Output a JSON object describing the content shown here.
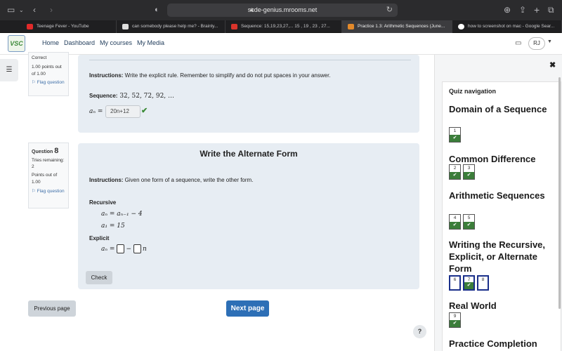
{
  "browser": {
    "url": "scde-genius.mrooms.net",
    "tabs": [
      {
        "label": "Teenage Fever - YouTube",
        "color": "#e22a2a"
      },
      {
        "label": "can somebody please help me? - Brainly...",
        "color": "#dddddd"
      },
      {
        "label": "Sequence: 15,19,23,27,... 15 , 19 , 23 , 27...",
        "color": "#d9342b"
      },
      {
        "label": "Practice 1.3: Arithmetic Sequences (June...",
        "color": "#e48a2a"
      },
      {
        "label": "how to screenshot on mac - Google Sear...",
        "color": "#ffffff"
      }
    ]
  },
  "site": {
    "logo_text": "VSC",
    "nav": {
      "home": "Home",
      "dashboard": "Dashboard",
      "courses": "My courses",
      "media": "My Media"
    },
    "user_initials": "RJ"
  },
  "q7": {
    "status": "Correct",
    "points": "1.00 points out of 1.00",
    "flag": "Flag question",
    "instructions_label": "Instructions:",
    "instructions": " Write the explicit rule. Remember to simplify and do not put spaces in your answer.",
    "sequence_label": "Sequence:",
    "sequence": " 32, 52, 72, 92, …",
    "lhs": "aₙ =",
    "answer": "20n+12"
  },
  "q8": {
    "label": "Question",
    "number": "8",
    "tries": "Tries remaining: 2",
    "points": "Points out of 1.00",
    "flag": "Flag question",
    "title": "Write the Alternate Form",
    "instructions_label": "Instructions:",
    "instructions": " Given one form of a sequence, write the other form.",
    "recursive_label": "Recursive",
    "recursive_eq1": "aₙ = aₙ₋₁ − 4",
    "recursive_eq2": "a₁ = 15",
    "explicit_label": "Explicit",
    "explicit_lhs": "aₙ =",
    "explicit_minus": "−",
    "explicit_var": "n",
    "check": "Check"
  },
  "footer": {
    "prev": "Previous page",
    "next": "Next page",
    "help": "?"
  },
  "quiz_nav": {
    "title": "Quiz navigation",
    "sections": [
      {
        "title": "Domain of a Sequence",
        "questions": [
          {
            "n": "1",
            "state": "done"
          }
        ]
      },
      {
        "title": "Common Difference",
        "questions": [
          {
            "n": "2",
            "state": "done"
          },
          {
            "n": "3",
            "state": "done"
          }
        ]
      },
      {
        "title": "Arithmetic Sequences",
        "questions": [
          {
            "n": "4",
            "state": "done"
          },
          {
            "n": "5",
            "state": "done"
          }
        ]
      },
      {
        "title": "Writing the Recursive, Explicit, or Alternate Form",
        "questions": [
          {
            "n": "6",
            "state": "unanswered"
          },
          {
            "n": "7",
            "state": "done"
          },
          {
            "n": "8",
            "state": "current"
          }
        ]
      },
      {
        "title": "Real World",
        "questions": [
          {
            "n": "9",
            "state": "done"
          }
        ]
      },
      {
        "title": "Practice Completion",
        "questions": []
      }
    ]
  },
  "colors": {
    "accent": "#2d6fb6",
    "done": "#3b7d3a",
    "current": "#1a2f8a"
  }
}
